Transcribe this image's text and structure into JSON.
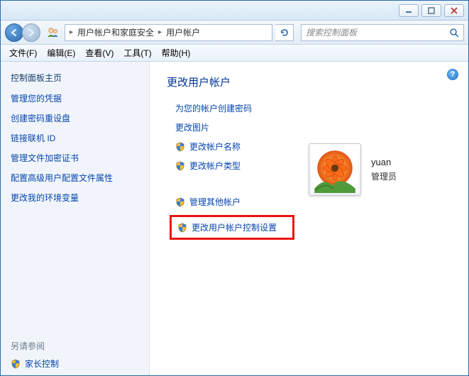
{
  "titlebar": {
    "minimize": "minimize",
    "maximize": "maximize",
    "close": "close"
  },
  "nav": {
    "breadcrumb": [
      "用户帐户和家庭安全",
      "用户帐户"
    ],
    "search_placeholder": "搜索控制面板"
  },
  "menubar": {
    "file": "文件(F)",
    "edit": "编辑(E)",
    "view": "查看(V)",
    "tools": "工具(T)",
    "help": "帮助(H)"
  },
  "sidebar": {
    "title": "控制面板主页",
    "links": [
      "管理您的凭据",
      "创建密码重设盘",
      "链接联机 ID",
      "管理文件加密证书",
      "配置高级用户配置文件属性",
      "更改我的环境变量"
    ],
    "see_also": "另请参阅",
    "parental": "家长控制"
  },
  "main": {
    "title": "更改用户帐户",
    "actions_plain": [
      "为您的帐户创建密码",
      "更改图片"
    ],
    "actions_shield": [
      "更改帐户名称",
      "更改帐户类型"
    ],
    "actions_other": "管理其他帐户",
    "actions_uac": "更改用户帐户控制设置",
    "user": {
      "name": "yuan",
      "role": "管理员"
    }
  }
}
